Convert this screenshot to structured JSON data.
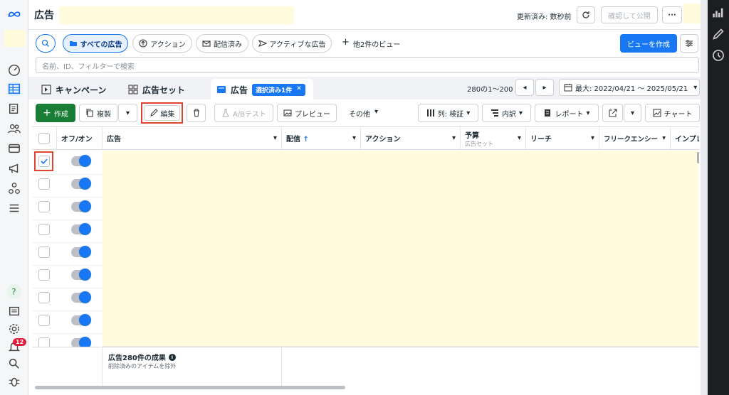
{
  "header": {
    "title": "広告",
    "updated": "更新済み: 数秒前",
    "confirm_publish": "確認して公開",
    "more": "···"
  },
  "views": {
    "all_ads": "すべての広告",
    "action": "アクション",
    "delivered": "配信済み",
    "active_ads": "アクティブな広告",
    "other_views": "他2件のビュー",
    "create_view": "ビューを作成"
  },
  "search": {
    "placeholder": "名前、ID、フィルターで検索"
  },
  "tabs": {
    "campaign": "キャンペーン",
    "adset": "広告セット",
    "ad": "広告",
    "selected": "選択済み1件"
  },
  "pagination": {
    "range": "280の1〜200"
  },
  "date_range": "最大: 2022/04/21 〜 2025/05/21",
  "toolbar": {
    "create": "作成",
    "duplicate": "複製",
    "edit": "編集",
    "ab_test": "A/Bテスト",
    "preview": "プレビュー",
    "other": "その他",
    "columns": "列: 検証",
    "breakdown": "内訳",
    "report": "レポート",
    "chart": "チャート"
  },
  "columns": {
    "onoff": "オフ/オン",
    "ad": "広告",
    "delivery": "配信",
    "action": "アクション",
    "budget": "予算",
    "budget_sub": "広告セット",
    "reach": "リーチ",
    "frequency": "フリークエンシー",
    "impressions": "インプレ"
  },
  "footer": {
    "results": "広告280件の成果",
    "excluded": "削除済みのアイテムを除外"
  },
  "notifications": {
    "count": "12"
  },
  "colors": {
    "accent": "#1877f2",
    "create_green": "#1a7d36",
    "highlight": "#e0432f",
    "redacted": "#fffbdc"
  }
}
